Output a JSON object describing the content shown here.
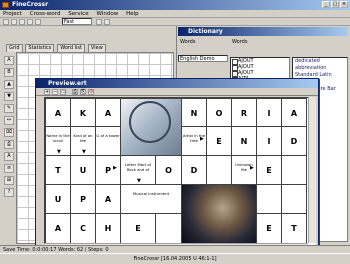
{
  "app": {
    "title": "FineCrossr",
    "menu": [
      "Project",
      "Cross-word",
      "Service",
      "Window",
      "Help"
    ],
    "zoom_field": "Fast",
    "tabs": [
      "Grid",
      "Statistics",
      "Word list",
      "View"
    ],
    "side_tools": [
      "A",
      "B",
      "▲",
      "▼",
      "✎",
      "↔",
      "⌧",
      "⎙",
      "A",
      "≡",
      "⊞",
      "?"
    ]
  },
  "dictionary": {
    "title": "Dictionary",
    "label_left": "Words",
    "label_right": "Words",
    "dictionary_select": "English Demo",
    "list": [
      "AJOUT",
      "AJOUT",
      "AJOUT",
      "AJTA"
    ],
    "right_list": [
      "dedicated abbreviation",
      "Standard Latin",
      "Console",
      "Architecture Bar",
      "",
      "",
      "",
      "",
      "",
      "",
      "",
      "",
      "",
      "",
      "",
      "",
      "",
      "",
      "",
      "",
      ""
    ]
  },
  "preview": {
    "title": "Preview.ert",
    "rows": [
      [
        "A",
        "K",
        "A",
        "",
        "",
        "N",
        "O",
        "R",
        "I",
        "A",
        "",
        ""
      ],
      [
        "Name in the scroll",
        "Kind of an fee",
        "G of a tower",
        "",
        "",
        "Artist in the tree",
        "E",
        "N",
        "I",
        "D",
        "",
        ""
      ],
      [
        "T",
        "U",
        "P",
        "Letter Mart of Rock and of",
        "O",
        "D",
        "",
        "Unknown file",
        "E",
        "",
        "",
        ""
      ],
      [
        "U",
        "P",
        "A",
        "Musical instrument",
        "",
        "",
        "",
        "",
        "",
        "",
        "",
        ""
      ],
      [
        "A",
        "C",
        "H",
        "E",
        "",
        "",
        "",
        "",
        "",
        "E",
        "T",
        ""
      ]
    ]
  },
  "status": {
    "text": "Save Time: 0:0:00:17 Words: 62 / Steps: 0"
  },
  "taskbar": {
    "text": "FineCrossr [16.04.2005 U 46:1-1]"
  }
}
